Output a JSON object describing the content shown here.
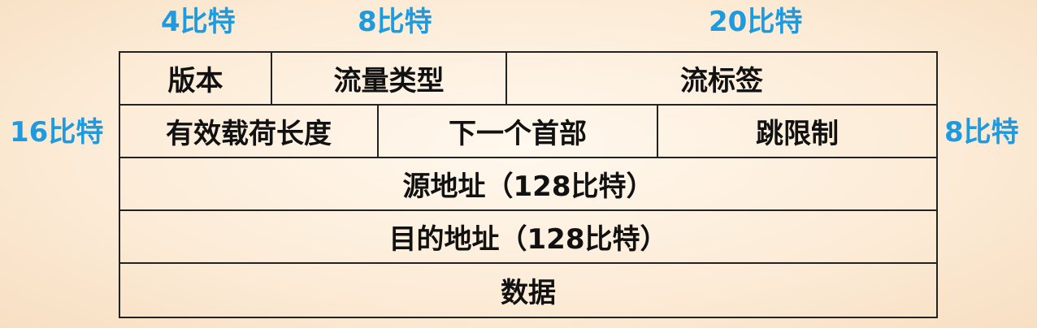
{
  "bit_labels": {
    "version": "4比特",
    "traffic_class": "8比特",
    "flow_label": "20比特",
    "payload_length": "16比特",
    "hop_limit": "8比特"
  },
  "rows": [
    [
      {
        "label": "版本"
      },
      {
        "label": "流量类型"
      },
      {
        "label": "流标签"
      }
    ],
    [
      {
        "label": "有效载荷长度"
      },
      {
        "label": "下一个首部"
      },
      {
        "label": "跳限制"
      }
    ],
    [
      {
        "label": "源地址（128比特）"
      }
    ],
    [
      {
        "label": "目的地址（128比特）"
      }
    ],
    [
      {
        "label": "数据"
      }
    ]
  ],
  "colors": {
    "bit_label": "#1e9be0",
    "border": "#222222",
    "text": "#111111"
  }
}
